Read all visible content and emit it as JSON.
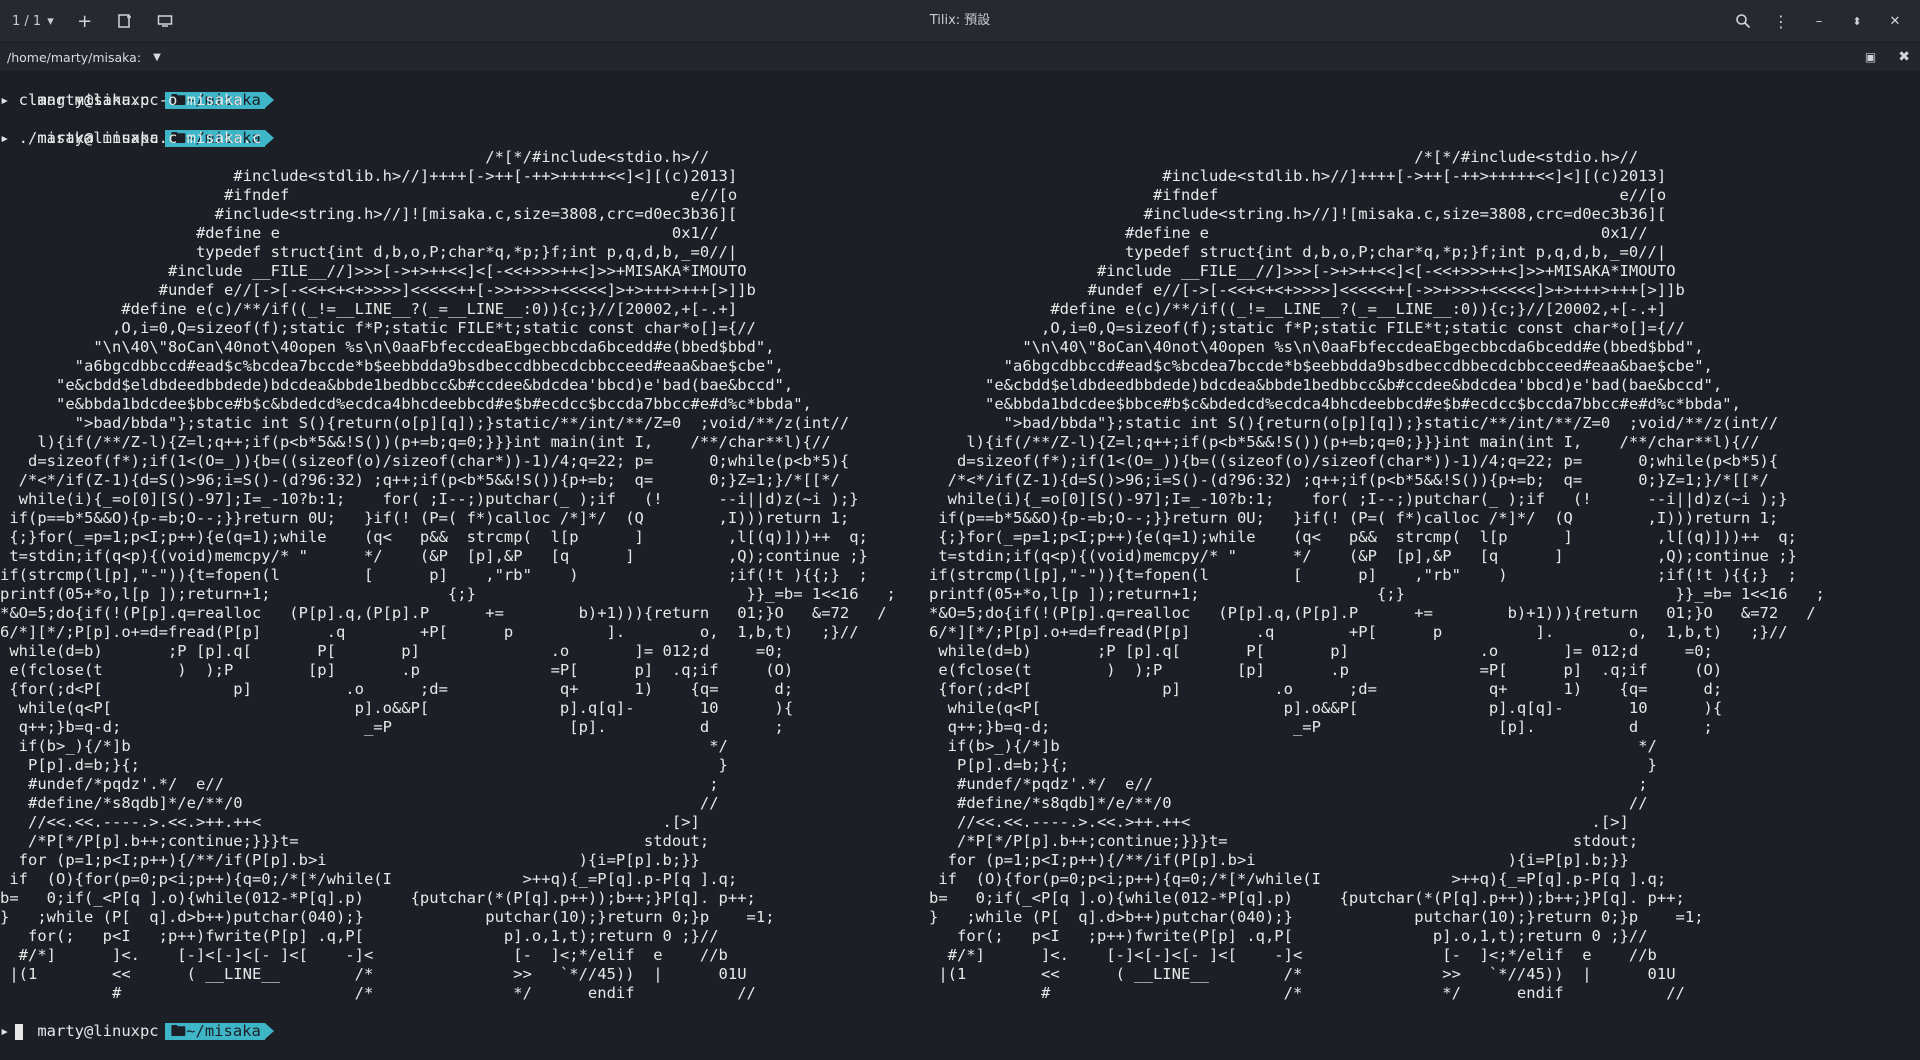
{
  "window": {
    "session_selector": "1 / 1",
    "title": "Tilix: 預設",
    "terminal_path": "/home/marty/misaka:"
  },
  "prompt": {
    "user_host": "marty@linuxpc",
    "dir": "~/misaka"
  },
  "commands": [
    "clang misaka.c -o misaka",
    "./misaka misaka.c misaka.c"
  ],
  "output_lines": [
    "                                                    /*[*/#include<stdio.h>//",
    "                         #include<stdlib.h>//]++++[->++[-++>+++++<<]<][(c)2013]",
    "                        #ifndef                                           e//[o",
    "                       #include<string.h>//]![misaka.c,size=3808,crc=d0ec3b36][",
    "                     #define e                                          0x1//",
    "                     typedef struct{int d,b,o,P;char*q,*p;}f;int p,q,d,b,_=0//|",
    "                  #include __FILE__//]>>>[->+>++<<]<[-<<+>>>++<]>>+MISAKA*IMOUTO",
    "                 #undef e//[->[-<<+<+<+>>>>]<<<<<++[->>+>>>+<<<<<]>+>+++>+++[>]]b",
    "             #define e(c)/**/if((_!=__LINE__?(_=__LINE__:0)){c;}//[20002,+[-.+]",
    "            ,O,i=0,Q=sizeof(f);static f*P;static FILE*t;static const char*o[]={//",
    "          \"\\n\\40\\\"8oCan\\40not\\40open %s\\n\\0aaFbfeccdeaEbgecbbcda6bcedd#e(bbed$bbd\",",
    "        \"a6bgcdbbccd#ead$c%bcdea7bccde*b$eebbdda9bsdbeccdbbecdcbbcceed#eaa&bae$cbe\",",
    "      \"e&cbdd$eldbdeedbbdede)bdcdea&bbde1bedbbcc&b#ccdee&bdcdea'bbcd)e'bad(bae&bccd\",",
    "      \"e&bbda1bdcdee$bbce#b$c&bdedcd%ecdca4bhcdeebbcd#e$b#ecdcc$bccda7bbcc#e#d%c*bbda\",",
    "        \">bad/bbda\"};static int S(){return(o[p][q]);}static/**/int/**/Z=0  ;void/**/z(int//",
    "    l){if(/**/Z-l){Z=l;q++;if(p<b*5&&!S())(p+=b;q=0;}}}int main(int I,    /**/char**l){//",
    "   d=sizeof(f*);if(1<(O=_)){b=((sizeof(o)/sizeof(char*))-1)/4;q=22; p=      0;while(p<b*5){",
    "  /*<*/if(Z-1){d=S()>96;i=S()-(d?96:32) ;q++;if(p<b*5&&!S()){p+=b;  q=      0;}Z=1;}/*[[*/",
    "  while(i){_=o[0][S()-97];I=_-10?b:1;    for( ;I--;)putchar(_ );if   (!      --i||d)z(~i );}",
    " if(p==b*5&&O){p-=b;O--;}}return 0U;   }if(! (P=( f*)calloc /*]*/  (Q        ,I)))return 1;",
    " {;}for(_=p=1;p<I;p++){e(q=1);while    (q<   p&&  strcmp(  l[p      ]         ,l[(q)]))++  q;",
    " t=stdin;if(q<p){(void)memcpy/* \"      */    (&P  [p],&P   [q      ]          ,Q);continue ;}",
    "if(strcmp(l[p],\"-\")){t=fopen(l         [      p]    ,\"rb\"    )                ;if(!t ){{;}  ;",
    "printf(05+*o,l[p ]);return+1;                   {;}                             }}_=b= 1<<16   ;",
    "*&O=5;do{if(!(P[p].q=realloc   (P[p].q,(P[p].P      +=        b)+1))){return   01;}O   &=72   /",
    "6/*][*/;P[p].o+=d=fread(P[p]       .q        +P[      p          ].        o,  1,b,t)   ;}//",
    " while(d=b)       ;P [p].q[       P[       p]              .o       ]= 012;d     =0;",
    " e(fclose(t        )  );P        [p]       .p              =P[      p]  .q;if     (O)",
    " {for(;d<P[              p]          .o      ;d=            q+      1)    {q=      d;",
    "  while(q<P[                          p].o&&P[              p].q[q]-       10      ){",
    "  q++;}b=q-d;                          _=P                   [p].          d       ;",
    "  if(b>_){/*]b                                                              */",
    "   P[p].d=b;}{;                                                              }",
    "   #undef/*pqdz'.*/  e//                                                    ;",
    "   #define/*s8qdb]*/e/**/0                                                 //",
    "   //<<.<<.----.>.<<.>++.++<                                           .[>]",
    "   /*P[*/P[p].b++;continue;}}}t=                                     stdout;",
    "  for (p=1;p<I;p++){/**/if(P[p].b>i                           ){i=P[p].b;}}",
    " if  (O){for(p=0;p<i;p++){q=0;/*[*/while(I              >++q){_=P[q].p-P[q ].q;",
    "b=   0;if(_<P[q ].o){while(012-*P[q].p)     {putchar(*(P[q].p++));b++;}P[q]. p++;",
    "}   ;while (P[  q].d>b++)putchar(040);}             putchar(10);}return 0;}p    =1;",
    "   for(;   p<I   ;p++)fwrite(P[p] .q,P[               p].o,1,t);return 0 ;}//",
    "  #/*]      ]<.    [-]<[-]<[- ]<[    -]<               [-  ]<;*/elif  e    //b",
    " |(1        <<      ( __LINE__        /*               >>   `*//45))  |      01U",
    "            #                         /*               */      endif           //"
  ]
}
